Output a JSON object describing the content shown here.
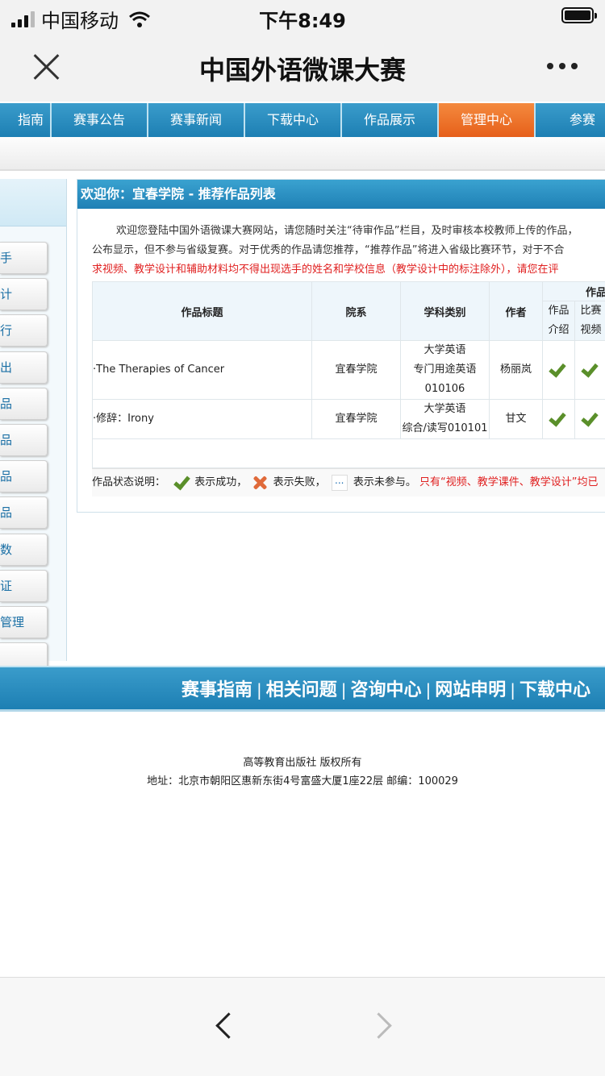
{
  "status_bar": {
    "carrier": "中国移动",
    "time": "下午8:49"
  },
  "titlebar": {
    "title": "中国外语微课大赛"
  },
  "nav": {
    "items": [
      {
        "label": "指南",
        "state": "normal"
      },
      {
        "label": "赛事公告",
        "state": "normal"
      },
      {
        "label": "赛事新闻",
        "state": "normal"
      },
      {
        "label": "下载中心",
        "state": "normal"
      },
      {
        "label": "作品展示",
        "state": "normal"
      },
      {
        "label": "管理中心",
        "state": "active"
      },
      {
        "label": "参赛",
        "state": "normal"
      }
    ]
  },
  "sidebar": {
    "items": [
      "手",
      "计",
      "行",
      "出",
      "品",
      "品",
      "品",
      "品",
      "数",
      "证",
      "管理",
      ""
    ]
  },
  "panel": {
    "header": "欢迎你：宜春学院 - 推荐作品列表",
    "notice_line1": "欢迎您登陆中国外语微课大赛网站，请您随时关注“待审作品”栏目，及时审核本校教师上传的作品，",
    "notice_line2": "公布显示，但不参与省级复赛。对于优秀的作品请您推荐，“推荐作品”将进入省级比赛环节，对于不合",
    "notice_line3": "求视频、教学设计和辅助材料均不得出现选手的姓名和学校信息（教学设计中的标注除外），请您在评"
  },
  "table": {
    "headers": {
      "title": "作品标题",
      "department": "院系",
      "subject": "学科类别",
      "author": "作者",
      "works": "作品",
      "intro_line1": "作品",
      "intro_line2": "介绍",
      "video_line1": "比赛",
      "video_line2": "视频"
    },
    "rows": [
      {
        "title": "·The Therapies of Cancer",
        "department": "宜春学院",
        "subject_line1": "大学英语",
        "subject_line2": "专门用途英语",
        "subject_line3": "010106",
        "author": "杨丽岚",
        "intro": "success",
        "video": "success"
      },
      {
        "title": "·修辞：Irony",
        "department": "宜春学院",
        "subject_line1": "大学英语",
        "subject_line2": "综合/读写010101",
        "subject_line3": "",
        "author": "甘文",
        "intro": "success",
        "video": "success"
      }
    ]
  },
  "legend": {
    "prefix": "作品状态说明：",
    "success": "表示成功，",
    "fail": "表示失败，",
    "na_icon": "...",
    "na": "表示未参与。",
    "note": "只有“视频、教学课件、教学设计”均已"
  },
  "footer": {
    "links": [
      "赛事指南",
      "相关问题",
      "咨询中心",
      "网站申明",
      "下载中心"
    ],
    "separator": "|",
    "publisher": "高等教育出版社 版权所有",
    "address": "地址：北京市朝阳区惠新东街4号富盛大厦1座22层 邮编：100029"
  },
  "icons": {
    "close": "close-icon",
    "more": "more-icon",
    "back": "back-arrow-icon",
    "forward": "forward-arrow-icon",
    "success": "check-icon",
    "fail": "cross-icon",
    "na": "ellipsis-icon"
  },
  "colors": {
    "nav_blue": "#1d7fb3",
    "nav_active": "#e65f1a",
    "notice_red": "#e02020",
    "check_green": "#5a8f2a"
  }
}
